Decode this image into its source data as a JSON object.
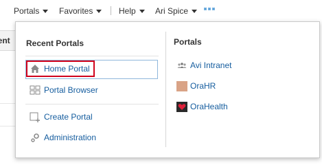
{
  "menubar": {
    "items": [
      {
        "label": "Portals"
      },
      {
        "label": "Favorites"
      },
      {
        "label": "Help"
      },
      {
        "label": "Ari Spice"
      }
    ]
  },
  "background": {
    "tab_fragment": "ment"
  },
  "dropdown": {
    "recent_portals": {
      "title": "Recent Portals",
      "items": [
        {
          "label": "Home Portal",
          "icon": "home-icon"
        },
        {
          "label": "Portal Browser",
          "icon": "portal-browser-icon"
        }
      ],
      "actions": [
        {
          "label": "Create Portal",
          "icon": "create-portal-icon"
        },
        {
          "label": "Administration",
          "icon": "administration-gear-icon"
        }
      ]
    },
    "portals": {
      "title": "Portals",
      "items": [
        {
          "label": "Avi Intranet",
          "icon": "people-group-icon"
        },
        {
          "label": "OraHR",
          "icon": "orahr-thumbnail-icon"
        },
        {
          "label": "OraHealth",
          "icon": "orahealth-heart-icon"
        }
      ]
    }
  },
  "colors": {
    "link": "#145c9e",
    "focus_outline": "#d0021b",
    "selected_border": "#8fb7dc"
  }
}
